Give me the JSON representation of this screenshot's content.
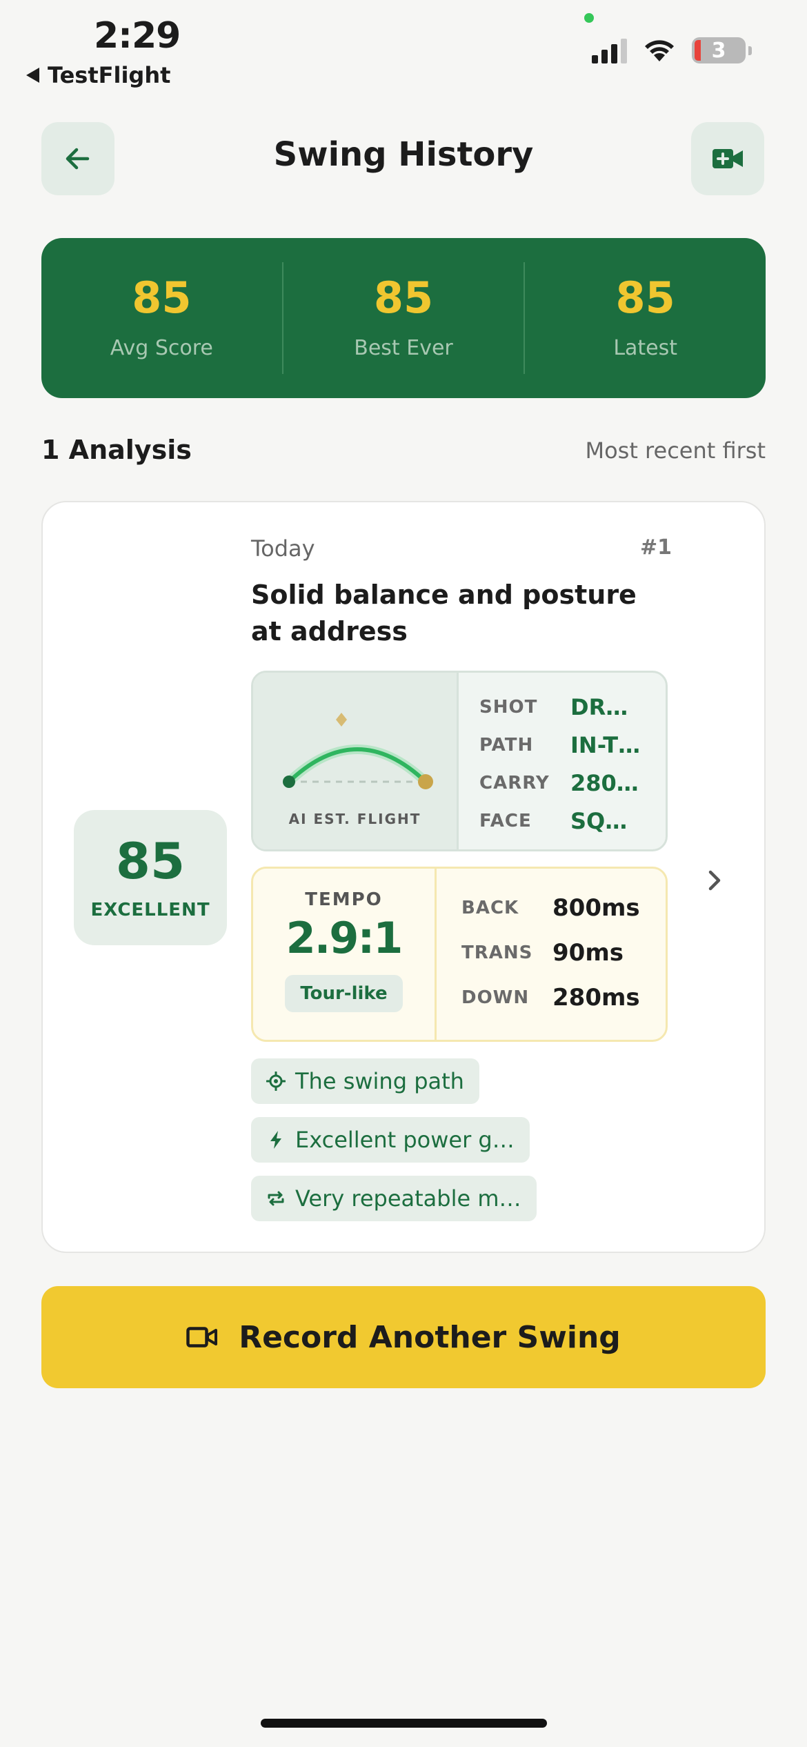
{
  "status_bar": {
    "time": "2:29",
    "back_app": "TestFlight",
    "battery": "3"
  },
  "header": {
    "title": "Swing History",
    "back_icon": "arrow-left-icon",
    "action_icon": "video-plus-icon"
  },
  "stats": [
    {
      "value": "85",
      "label": "Avg Score"
    },
    {
      "value": "85",
      "label": "Best Ever"
    },
    {
      "value": "85",
      "label": "Latest"
    }
  ],
  "section": {
    "title": "1 Analysis",
    "sort": "Most recent first"
  },
  "analysis": {
    "date": "Today",
    "index": "#1",
    "headline": "Solid balance and posture at address",
    "score": "85",
    "rating": "EXCELLENT",
    "flight_caption": "AI EST. FLIGHT",
    "flight": [
      {
        "key": "SHOT",
        "value": "DRAW"
      },
      {
        "key": "PATH",
        "value": "IN-T…"
      },
      {
        "key": "CARRY",
        "value": "280…"
      },
      {
        "key": "FACE",
        "value": "SQU…"
      }
    ],
    "tempo": {
      "label": "TEMPO",
      "ratio": "2.9:1",
      "badge": "Tour-like"
    },
    "phases": [
      {
        "key": "BACK",
        "value": "800ms"
      },
      {
        "key": "TRANS",
        "value": "90ms"
      },
      {
        "key": "DOWN",
        "value": "280ms"
      }
    ],
    "chips": [
      {
        "icon": "crosshair-icon",
        "text": "The swing path"
      },
      {
        "icon": "bolt-icon",
        "text": "Excellent power g…"
      },
      {
        "icon": "repeat-icon",
        "text": "Very repeatable m…"
      }
    ]
  },
  "record_button": {
    "label": "Record Another Swing",
    "icon": "video-icon"
  },
  "colors": {
    "brand_green": "#1c6e3f",
    "accent_yellow": "#f1c930",
    "score_yellow": "#f0c630"
  }
}
